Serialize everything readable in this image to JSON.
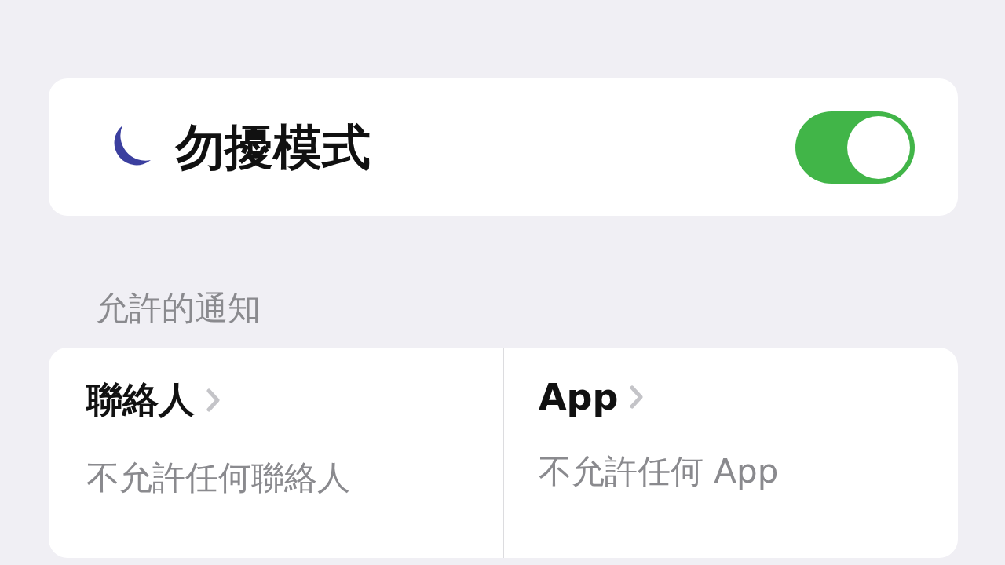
{
  "focus": {
    "title": "勿擾模式",
    "on": true
  },
  "section_header": "允許的通知",
  "allowed": [
    {
      "title": "聯絡人",
      "subtitle": "不允許任何聯絡人"
    },
    {
      "title": "App",
      "subtitle": "不允許任何 App"
    }
  ]
}
